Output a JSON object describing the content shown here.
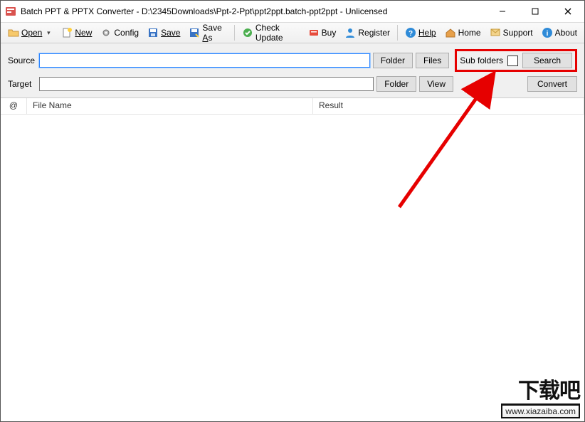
{
  "window": {
    "title": "Batch PPT & PPTX Converter - D:\\2345Downloads\\Ppt-2-Ppt\\ppt2ppt.batch-ppt2ppt - Unlicensed"
  },
  "toolbar": {
    "open": "Open",
    "new": "New",
    "config": "Config",
    "save": "Save",
    "save_as": "Save As",
    "check_update": "Check Update",
    "buy": "Buy",
    "register": "Register",
    "help": "Help",
    "home": "Home",
    "support": "Support",
    "about": "About"
  },
  "paths": {
    "source_label": "Source",
    "source_value": "",
    "target_label": "Target",
    "target_value": "",
    "folder_btn": "Folder",
    "files_btn": "Files",
    "view_btn": "View",
    "sub_folders_label": "Sub folders",
    "sub_folders_checked": false,
    "search_btn": "Search",
    "convert_btn": "Convert"
  },
  "table": {
    "col_at": "@",
    "col_filename": "File Name",
    "col_result": "Result",
    "rows": []
  },
  "watermark": {
    "big": "下载吧",
    "url": "www.xiazaiba.com"
  }
}
